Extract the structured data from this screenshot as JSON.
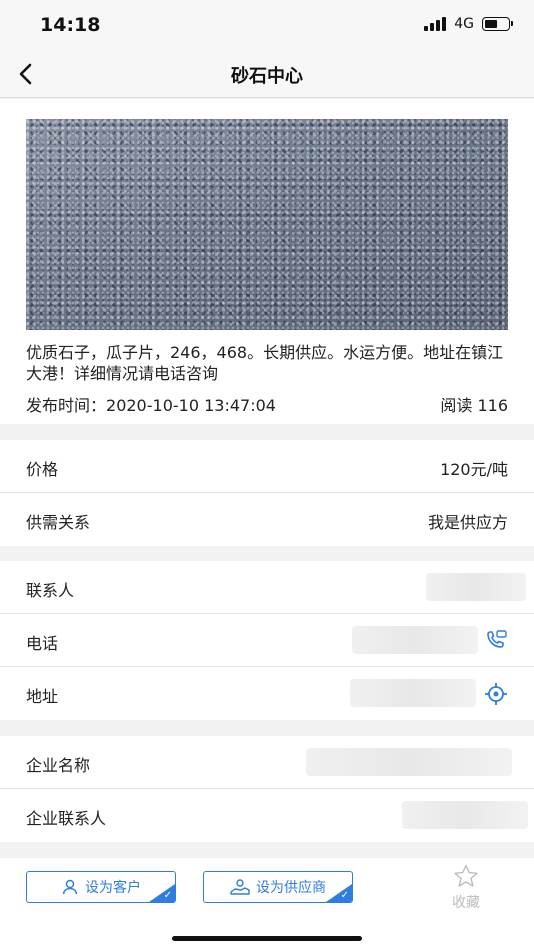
{
  "status": {
    "time": "14:18",
    "network": "4G"
  },
  "nav": {
    "title": "砂石中心"
  },
  "listing": {
    "description": "优质石子，瓜子片，246，468。长期供应。水运方便。地址在镇江大港！详细情况请电话咨询",
    "publish_label": "发布时间：",
    "publish_time": "2020-10-10 13:47:04",
    "read_label": "阅读",
    "read_count": "116",
    "image_alt": "gravel-photo"
  },
  "info": {
    "price_label": "价格",
    "price_value": "120元/吨",
    "relation_label": "供需关系",
    "relation_value": "我是供应方"
  },
  "contact": {
    "person_label": "联系人",
    "phone_label": "电话",
    "address_label": "地址"
  },
  "company": {
    "name_label": "企业名称",
    "contact_label": "企业联系人"
  },
  "actions": {
    "set_customer": "设为客户",
    "set_supplier": "设为供应商",
    "favorite": "收藏"
  },
  "colors": {
    "accent": "#2f7de1",
    "icon_blue": "#2f7de1"
  }
}
